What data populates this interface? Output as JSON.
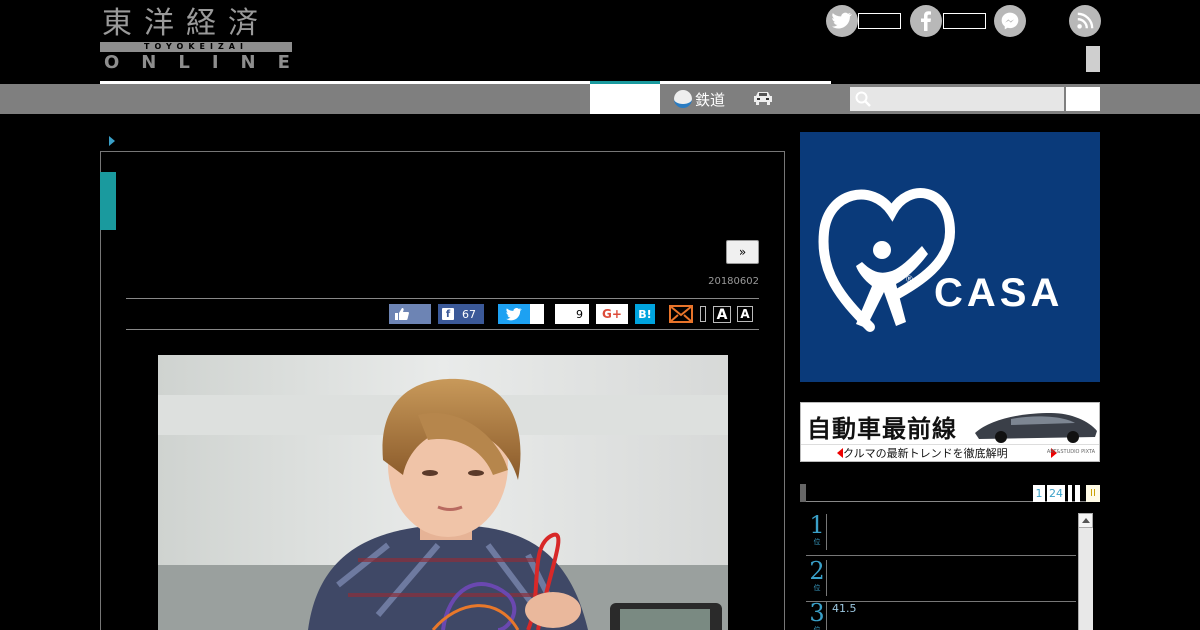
{
  "header": {
    "logo": {
      "kanji": "東洋経済",
      "roman": "TOYOKEIZAI",
      "online": "ONLINE"
    },
    "sns": [
      {
        "name": "twitter-icon",
        "glyph": "t"
      },
      {
        "name": "facebook-icon",
        "glyph": "f"
      },
      {
        "name": "messenger-icon",
        "glyph": "~"
      },
      {
        "name": "rss-icon",
        "glyph": ")"
      }
    ]
  },
  "nav": {
    "rail_label": "鉄道"
  },
  "search": {
    "placeholder": ""
  },
  "article": {
    "next_label": "»",
    "date": "20180602",
    "share": {
      "facebook_count": "67",
      "pocket_count": "9",
      "gplus_label": "G+",
      "hatena_label": "B!"
    },
    "font_large": "A",
    "font_small": "A"
  },
  "sidebar": {
    "ad_brand": "CASA",
    "banner_title": "自動車最前線",
    "banner_sub": "クルマの最新トレンドを徹底解明",
    "banner_credit": "ART&STUDIO PIXTA",
    "ranking_tabs": [
      "1",
      "24"
    ],
    "ranking_tab_extra": "II",
    "ranking": [
      {
        "rank": "1",
        "suffix": "位",
        "text": ""
      },
      {
        "rank": "2",
        "suffix": "位",
        "text": ""
      },
      {
        "rank": "3",
        "suffix": "位",
        "text": "41.5"
      }
    ]
  },
  "colors": {
    "accent": "#1a9a9e",
    "link": "#3aa0c8",
    "nav": "#7f7f7f",
    "casa_blue": "#0a3a7a"
  }
}
